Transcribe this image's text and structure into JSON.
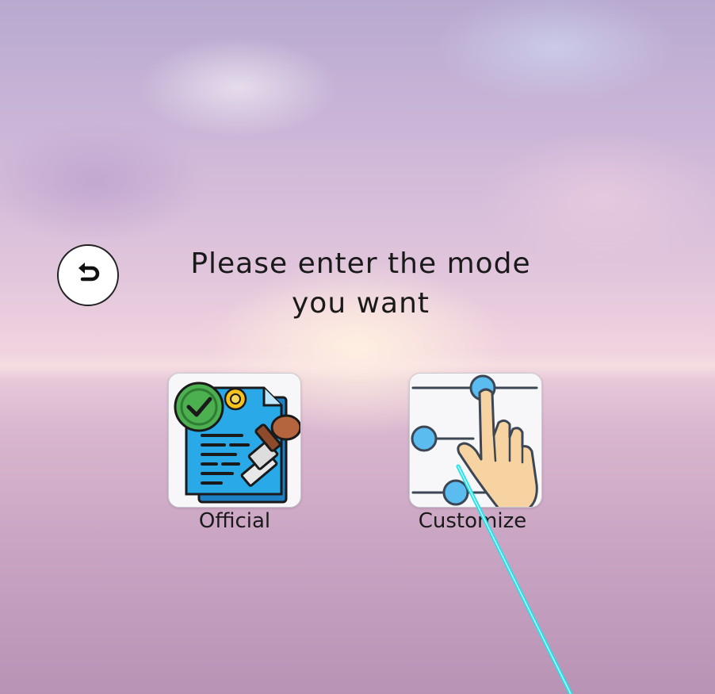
{
  "prompt": {
    "line1": "Please enter the mode",
    "line2": "you want"
  },
  "back_button": {
    "icon": "undo-arrow-icon"
  },
  "modes": [
    {
      "label": "Official",
      "icon": "certified-document-icon"
    },
    {
      "label": "Customize",
      "icon": "hand-slider-icon"
    }
  ],
  "colors": {
    "laser": "#22e0e8",
    "document_blue": "#29a9e8",
    "check_green": "#4caf50",
    "seal_yellow": "#f8c21d",
    "stamp_brown": "#b5653d",
    "slider_node": "#5bbcf0",
    "hand_skin": "#f6d3a0"
  }
}
